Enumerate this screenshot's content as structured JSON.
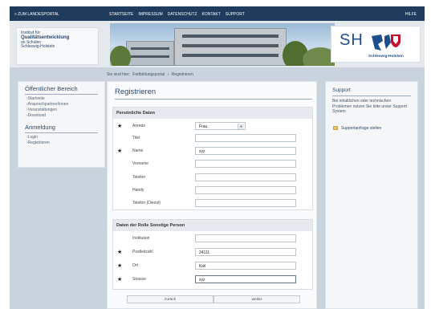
{
  "topnav": {
    "portal_link": "» ZUM LANDESPORTAL",
    "menu": [
      "STARTSEITE",
      "IMPRESSUM",
      "DATENSCHUTZ",
      "KONTAKT",
      "SUPPORT"
    ],
    "help": "HILFE"
  },
  "header": {
    "institute": [
      "Institut für",
      "Qualitätsentwicklung",
      "an Schulen",
      "Schleswig-Holstein"
    ],
    "logo_text": "SH",
    "logo_subtitle": "Schleswig-Holstein"
  },
  "breadcrumb": {
    "prefix": "Sie sind hier:",
    "path": "Fortbildungsportal",
    "sep": "›",
    "current": "Registrieren"
  },
  "sidebar": {
    "public_heading": "Öffentlicher Bereich",
    "public_items": [
      "Startseite",
      "Ansprechpartner/innen",
      "Veranstaltungen",
      "Download"
    ],
    "login_heading": "Anmeldung",
    "login_items": [
      "Login",
      "Registrieren"
    ]
  },
  "main": {
    "title": "Registrieren",
    "personal": {
      "heading": "Persönliche Daten",
      "fields": [
        {
          "label": "Anrede",
          "required": "★",
          "value": "Frau",
          "type": "select"
        },
        {
          "label": "Titel",
          "required": "",
          "value": "",
          "type": "text"
        },
        {
          "label": "Name",
          "required": "★",
          "value": "xyz",
          "type": "text"
        },
        {
          "label": "Vorname",
          "required": "",
          "value": "",
          "type": "text"
        },
        {
          "label": "Telefon",
          "required": "",
          "value": "",
          "type": "text"
        },
        {
          "label": "Handy",
          "required": "",
          "value": "",
          "type": "text"
        },
        {
          "label": "Telefon (Dienst)",
          "required": "",
          "value": "",
          "type": "text"
        }
      ]
    },
    "role": {
      "heading": "Daten der Rolle Sonstige Person",
      "fields": [
        {
          "label": "Institution",
          "required": "",
          "value": ""
        },
        {
          "label": "Postleitzahl",
          "required": "★",
          "value": "24111"
        },
        {
          "label": "Ort",
          "required": "★",
          "value": "Kiel"
        },
        {
          "label": "Strasse",
          "required": "★",
          "value": "xyz"
        }
      ]
    },
    "buttons": {
      "back": "zurück",
      "next": "weiter"
    }
  },
  "support": {
    "heading": "Support",
    "text": "Bei inhaltlichen oder technischen Problemen nutzen Sie bitte unser Support System",
    "link": "Supportanfrage stellen"
  },
  "colors": {
    "nav": "#1f3c5c",
    "accent": "#2b4a6a",
    "frame": "#c9d3dd"
  }
}
